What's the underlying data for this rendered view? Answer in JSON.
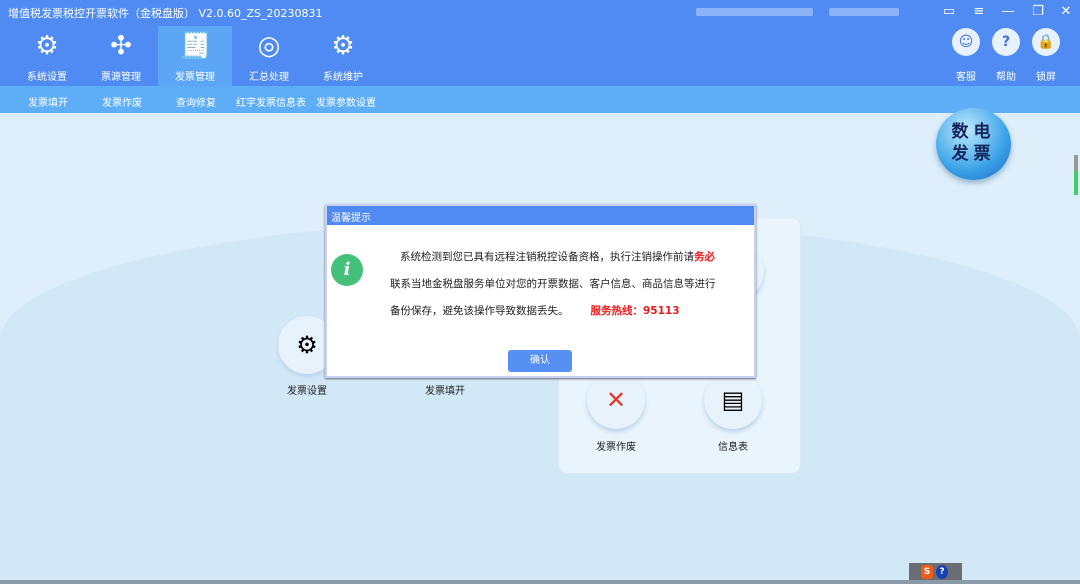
{
  "app": {
    "title": "增值税发票税控开票软件（金税盘版） V2.0.60_ZS_20230831"
  },
  "window_controls": {
    "feedback": "feedback-icon",
    "menu": "menu-icon",
    "minimize": "—",
    "restore": "❐",
    "close": "✕"
  },
  "toolbar": {
    "tabs": [
      {
        "label": "系统设置",
        "icon": "gear-icon"
      },
      {
        "label": "票源管理",
        "icon": "network-icon"
      },
      {
        "label": "发票管理",
        "icon": "invoice-icon",
        "active": true
      },
      {
        "label": "汇总处理",
        "icon": "tax-summary-icon"
      },
      {
        "label": "系统维护",
        "icon": "wrench-icon"
      }
    ],
    "right": [
      {
        "label": "客服",
        "icon": "robot-icon"
      },
      {
        "label": "帮助",
        "icon": "help-book-icon"
      },
      {
        "label": "锁屏",
        "icon": "lock-icon"
      }
    ]
  },
  "subnav": [
    "发票填开",
    "发票作废",
    "查询修复",
    "红字发票信息表",
    "发票参数设置"
  ],
  "badge": {
    "line1": "数电",
    "line2": "发票"
  },
  "functions": [
    {
      "label": "发票设置"
    },
    {
      "label": "发票填开"
    },
    {
      "label": "发票作废"
    },
    {
      "label": "信息表"
    }
  ],
  "dialog": {
    "title": "温馨提示",
    "line1": "系统检测到您已具有远程注销税控设备资格，执行注销操作前请",
    "line1_emph": "务必",
    "line2": "联系当地金税盘服务单位对您的开票数据、客户信息、商品信息等进行",
    "line3": "备份保存，避免该操作导致数据丢失。",
    "hotline": "服务热线：95113",
    "ok": "确认"
  },
  "colors": {
    "primary": "#4f8bf2",
    "subnav": "#5eaef7",
    "warning": "#f01818",
    "info": "#45c07a"
  }
}
